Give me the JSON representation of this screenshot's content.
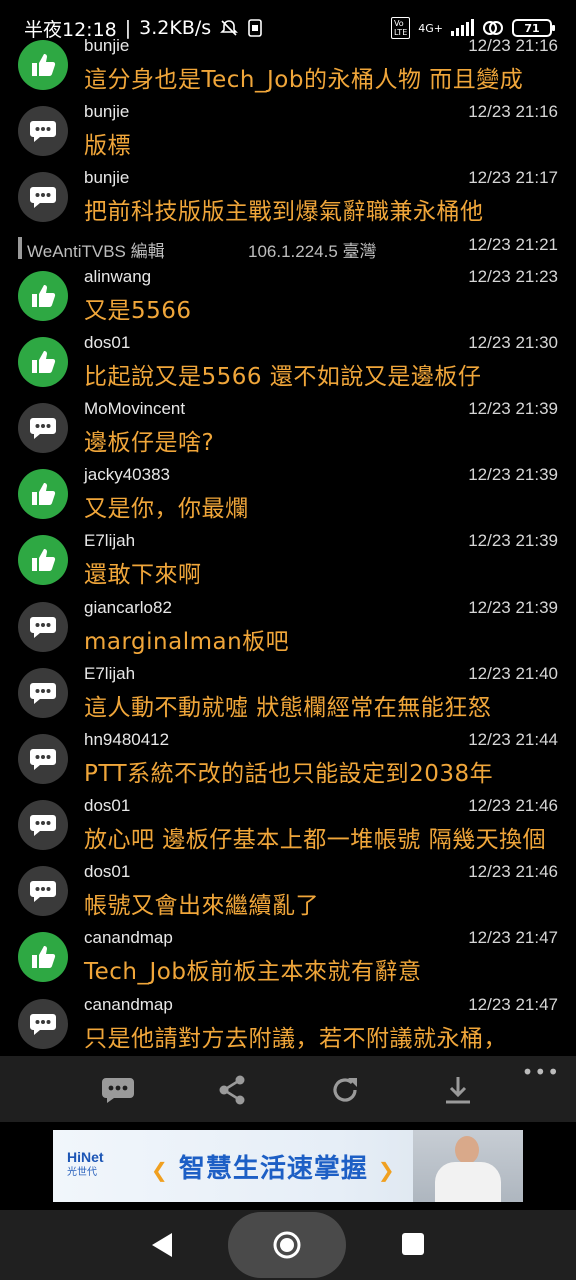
{
  "status": {
    "time": "半夜12:18",
    "speed": "3.2KB/s",
    "network": "4G+",
    "battery": "71"
  },
  "comments_before_edit": [
    {
      "type": "like",
      "user": "bunjie",
      "time": "12/23 21:16",
      "text": "這分身也是Tech_Job的永桶人物 而且變成"
    },
    {
      "type": "comment",
      "user": "bunjie",
      "time": "12/23 21:16",
      "text": "版標"
    },
    {
      "type": "comment",
      "user": "bunjie",
      "time": "12/23 21:17",
      "text": "把前科技版版主戰到爆氣辭職兼永桶他"
    }
  ],
  "edit_line": {
    "user": "WeAntiTVBS 編輯",
    "ip": "106.1.224.5 臺灣",
    "time": "12/23 21:21"
  },
  "comments_after_edit": [
    {
      "type": "like",
      "user": "alinwang",
      "time": "12/23 21:23",
      "text": "又是5566"
    },
    {
      "type": "like",
      "user": "dos01",
      "time": "12/23 21:30",
      "text": "比起說又是5566 還不如說又是邊板仔"
    },
    {
      "type": "comment",
      "user": "MoMovincent",
      "time": "12/23 21:39",
      "text": "邊板仔是啥?"
    },
    {
      "type": "like",
      "user": "jacky40383",
      "time": "12/23 21:39",
      "text": "又是你，你最爛"
    },
    {
      "type": "like",
      "user": "E7lijah",
      "time": "12/23 21:39",
      "text": "還敢下來啊"
    },
    {
      "type": "comment",
      "user": "giancarlo82",
      "time": "12/23 21:39",
      "text": "marginalman板吧"
    },
    {
      "type": "comment",
      "user": "E7lijah",
      "time": "12/23 21:40",
      "text": "這人動不動就噓 狀態欄經常在無能狂怒"
    },
    {
      "type": "comment",
      "user": "hn9480412",
      "time": "12/23 21:44",
      "text": "PTT系統不改的話也只能設定到2038年"
    },
    {
      "type": "comment",
      "user": "dos01",
      "time": "12/23 21:46",
      "text": "放心吧 邊板仔基本上都一堆帳號 隔幾天換個"
    },
    {
      "type": "comment",
      "user": "dos01",
      "time": "12/23 21:46",
      "text": "帳號又會出來繼續亂了"
    },
    {
      "type": "like",
      "user": "canandmap",
      "time": "12/23 21:47",
      "text": "Tech_Job板前板主本來就有辭意"
    },
    {
      "type": "comment",
      "user": "canandmap",
      "time": "12/23 21:47",
      "text": "只是他請對方去附議，若不附議就永桶，"
    }
  ],
  "toolbar": {
    "items": [
      "comment-icon",
      "share-icon",
      "refresh-icon",
      "download-icon"
    ],
    "more": "•••"
  },
  "ad": {
    "logo_main": "HiNet",
    "logo_sub": "光世代",
    "slogan": "智慧生活速掌握"
  },
  "colors": {
    "like": "#2ea843",
    "comment": "#3a3a3a",
    "text": "#f0a63a"
  }
}
